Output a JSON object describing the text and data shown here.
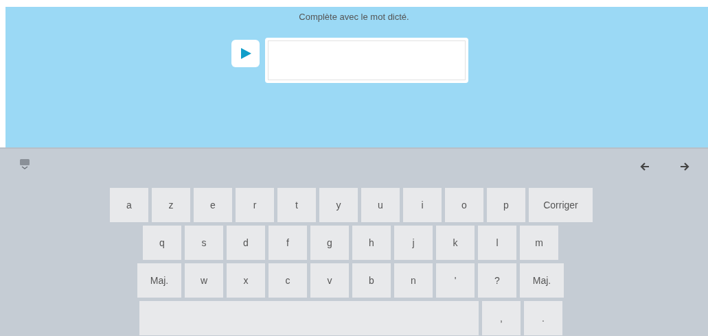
{
  "instruction": "Complète avec le mot dicté.",
  "keyboard": {
    "rows": [
      {
        "keys": [
          {
            "kind": "key",
            "label": "a"
          },
          {
            "kind": "key",
            "label": "z"
          },
          {
            "kind": "key",
            "label": "e"
          },
          {
            "kind": "key",
            "label": "r"
          },
          {
            "kind": "key",
            "label": "t"
          },
          {
            "kind": "key",
            "label": "y"
          },
          {
            "kind": "key",
            "label": "u"
          },
          {
            "kind": "key",
            "label": "i"
          },
          {
            "kind": "key",
            "label": "o"
          },
          {
            "kind": "key",
            "label": "p"
          },
          {
            "kind": "wide",
            "label": "Corriger"
          }
        ]
      },
      {
        "keys": [
          {
            "kind": "key",
            "label": "q"
          },
          {
            "kind": "key",
            "label": "s"
          },
          {
            "kind": "key",
            "label": "d"
          },
          {
            "kind": "key",
            "label": "f"
          },
          {
            "kind": "key",
            "label": "g"
          },
          {
            "kind": "key",
            "label": "h"
          },
          {
            "kind": "key",
            "label": "j"
          },
          {
            "kind": "key",
            "label": "k"
          },
          {
            "kind": "key",
            "label": "l"
          },
          {
            "kind": "key",
            "label": "m"
          }
        ]
      },
      {
        "keys": [
          {
            "kind": "shift",
            "label": "Maj."
          },
          {
            "kind": "key",
            "label": "w"
          },
          {
            "kind": "key",
            "label": "x"
          },
          {
            "kind": "key",
            "label": "c"
          },
          {
            "kind": "key",
            "label": "v"
          },
          {
            "kind": "key",
            "label": "b"
          },
          {
            "kind": "key",
            "label": "n"
          },
          {
            "kind": "key",
            "label": "'"
          },
          {
            "kind": "key",
            "label": "?"
          },
          {
            "kind": "shift",
            "label": "Maj."
          }
        ]
      },
      {
        "keys": [
          {
            "kind": "space"
          },
          {
            "kind": "key",
            "label": ","
          },
          {
            "kind": "key",
            "label": "."
          }
        ]
      }
    ]
  }
}
